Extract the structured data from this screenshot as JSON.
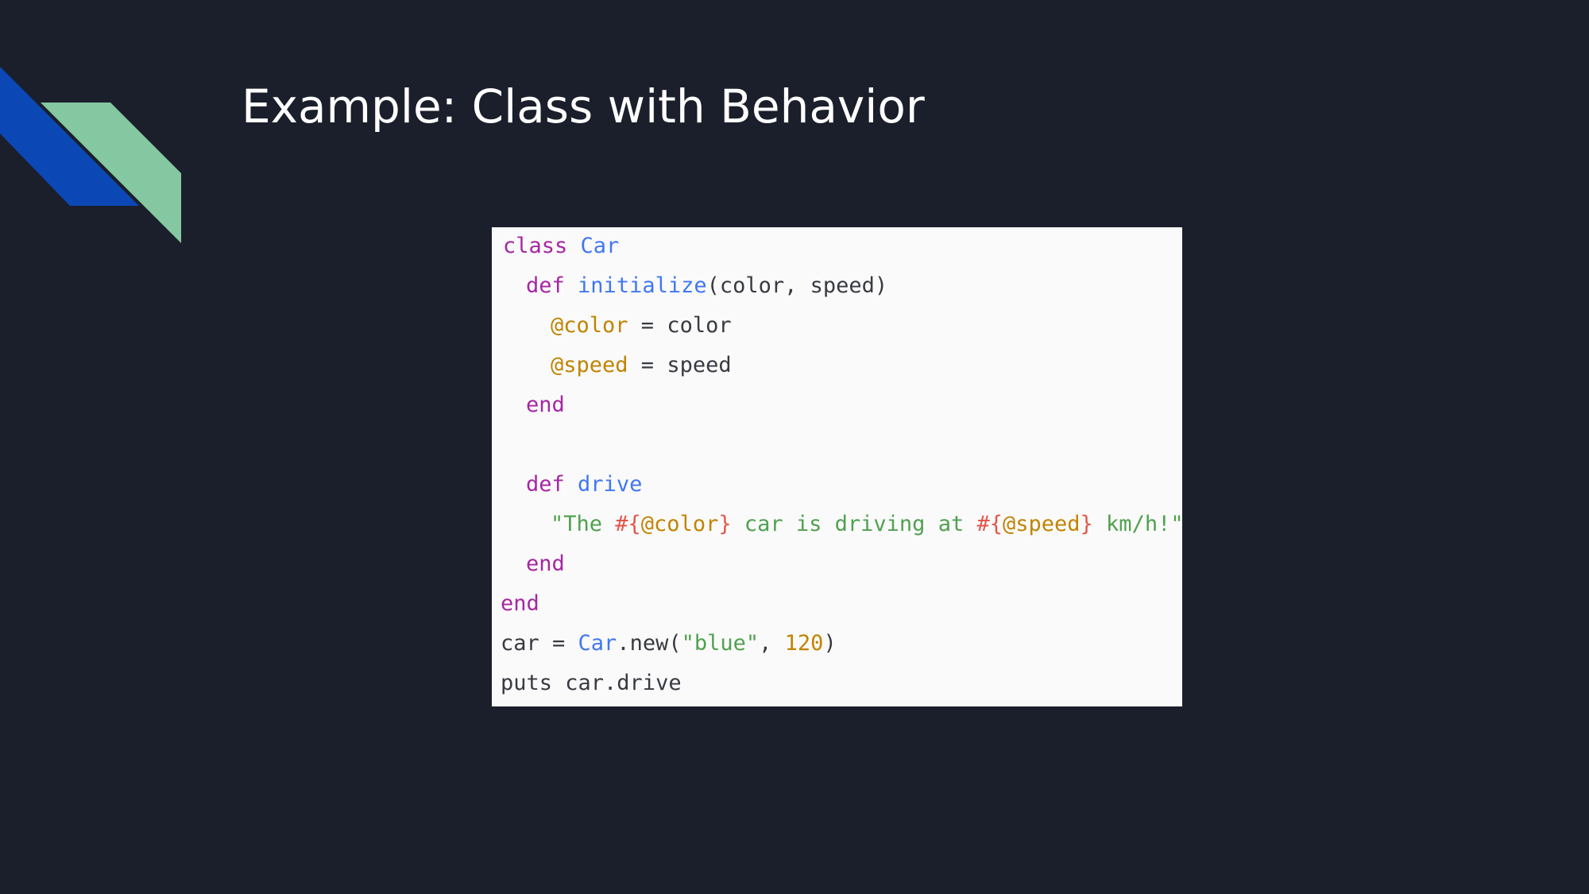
{
  "slide": {
    "title": "Example: Class with Behavior"
  },
  "colors": {
    "background": "#1b1f2b",
    "deco_blue": "#0b47b5",
    "deco_green": "#84c7a0",
    "code_background": "#fafafa",
    "keyword": "#a626a4",
    "function": "#4078f2",
    "instance_variable": "#c18401",
    "string": "#50a14f",
    "interpolation": "#e45649",
    "plain": "#383a42"
  },
  "code": {
    "l1": {
      "kw": "class",
      "sp": " ",
      "name": "Car"
    },
    "l2": {
      "kw": "def",
      "sp": " ",
      "name": "initialize",
      "rest": "(color, speed)"
    },
    "l3": {
      "ivar": "@color",
      "rest": " = color"
    },
    "l4": {
      "ivar": "@speed",
      "rest": " = speed"
    },
    "l5": {
      "kw": "end"
    },
    "l7": {
      "kw": "def",
      "sp": " ",
      "name": "drive"
    },
    "l8": {
      "s1": "\"The ",
      "i1_open": "#{",
      "i1_var": "@color",
      "i1_close": "}",
      "s2": " car is driving at ",
      "i2_open": "#{",
      "i2_var": "@speed",
      "i2_close": "}",
      "s3": " km/h!\""
    },
    "l9": {
      "kw": "end"
    },
    "l10": {
      "kw": "end"
    },
    "l11": {
      "a": "car = ",
      "cls": "Car",
      "b": ".new(",
      "str": "\"blue\"",
      "c": ", ",
      "num": "120",
      "d": ")"
    },
    "l12": {
      "text": "puts car.drive"
    }
  }
}
